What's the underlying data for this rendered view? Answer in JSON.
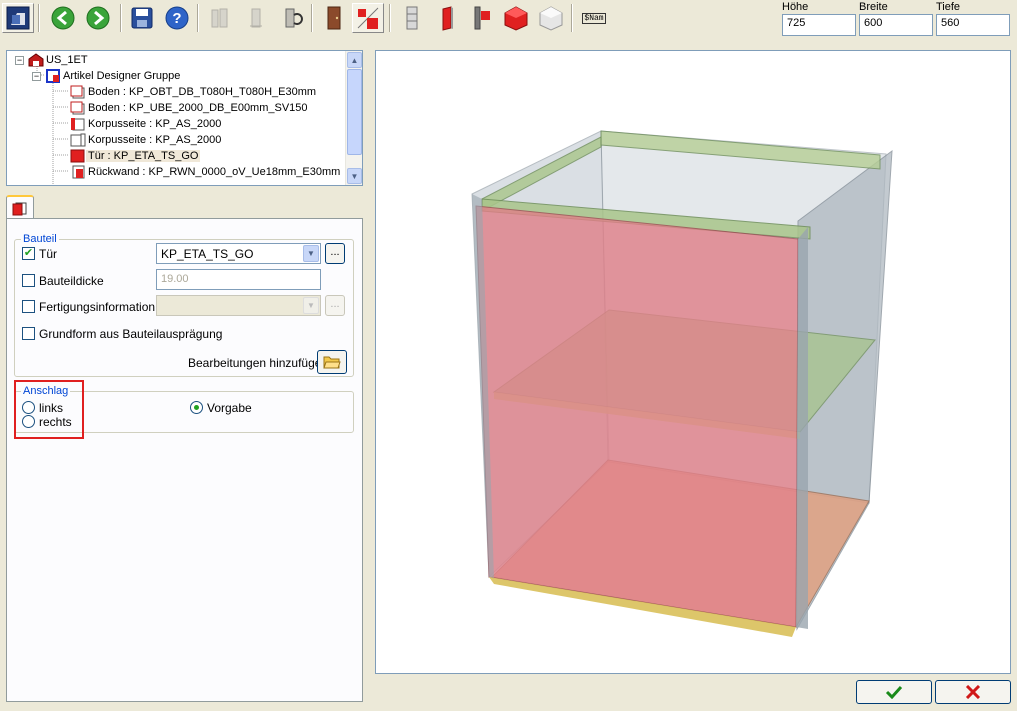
{
  "toolbar": {
    "icons": [
      "app-icon",
      "back-icon",
      "forward-icon",
      "save-icon",
      "help-icon",
      "tool-disabled-1-icon",
      "tool-disabled-2-icon",
      "tool-3-icon",
      "door-tool-icon",
      "door-piece-tool-icon",
      "shelf-stack-icon",
      "side-panel-icon",
      "panel-hinge-icon",
      "cube-red-icon",
      "cube-white-icon",
      "name-icon"
    ],
    "name_button_label": "$Nam",
    "dimensions": {
      "height_label": "Höhe",
      "height_value": "725",
      "width_label": "Breite",
      "width_value": "600",
      "depth_label": "Tiefe",
      "depth_value": "560"
    }
  },
  "tree": {
    "items": [
      {
        "label": "US_1ET"
      },
      {
        "label": "Artikel Designer Gruppe"
      },
      {
        "label": "Boden : KP_OBT_DB_T080H_T080H_E30mm"
      },
      {
        "label": "Boden : KP_UBE_2000_DB_E00mm_SV150"
      },
      {
        "label": "Korpusseite : KP_AS_2000"
      },
      {
        "label": "Korpusseite : KP_AS_2000"
      },
      {
        "label": "Tür : KP_ETA_TS_GO"
      },
      {
        "label": "Rückwand : KP_RWN_0000_oV_Ue18mm_E30mm"
      }
    ]
  },
  "props": {
    "group_title": "Bauteil",
    "door_label": "Tür",
    "door_checked": true,
    "door_value": "KP_ETA_TS_GO",
    "ellipsis": "...",
    "thickness_label": "Bauteildicke",
    "thickness_value": "19.00",
    "fabrication_label": "Fertigungsinformation",
    "base_shape_label": "Grundform aus Bauteilausprägung",
    "add_processing_label": "Bearbeitungen hinzufügen",
    "hinge_group_title": "Anschlag",
    "hinge_left": "links",
    "hinge_right": "rechts",
    "hinge_default": "Vorgabe",
    "hinge_selected": "Vorgabe"
  },
  "colors": {
    "accent_red": "#e02020",
    "cabinet_glass": "#a9b4bd",
    "door_pink": "#e07f88",
    "shelf_green": "#9cc28a"
  }
}
